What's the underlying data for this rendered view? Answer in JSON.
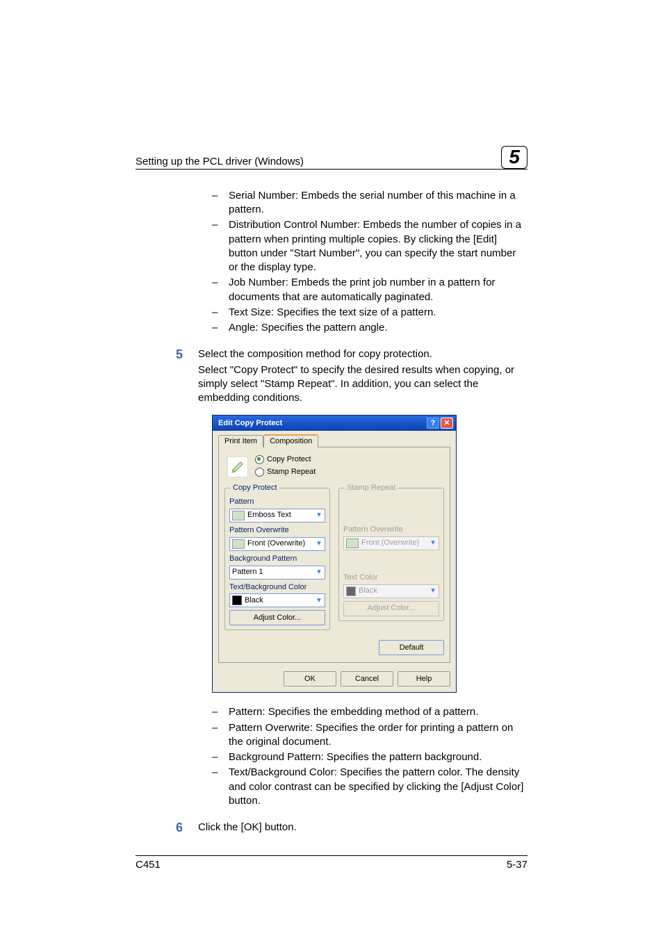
{
  "header": {
    "title": "Setting up the PCL driver (Windows)",
    "chapter": "5"
  },
  "bullets1": [
    "Serial Number: Embeds the serial number of this machine in a pattern.",
    "Distribution Control Number: Embeds the number of copies in a pattern when printing multiple copies. By clicking the [Edit] button under \"Start Number\", you can specify the start number or the display type.",
    "Job Number: Embeds the print job number in a pattern for documents that are automatically paginated.",
    "Text Size: Specifies the text size of a pattern.",
    "Angle: Specifies the pattern angle."
  ],
  "step5": {
    "num": "5",
    "line1": "Select the composition method for copy protection.",
    "line2": "Select \"Copy Protect\" to specify the desired results when copying, or simply select \"Stamp Repeat\". In addition, you can select the embedding conditions."
  },
  "dialog": {
    "title": "Edit Copy Protect",
    "tabs": {
      "t1": "Print Item",
      "t2": "Composition"
    },
    "radios": {
      "r1": "Copy Protect",
      "r2": "Stamp Repeat"
    },
    "left": {
      "group": "Copy Protect",
      "pattern_label": "Pattern",
      "pattern_value": "Emboss Text",
      "overwrite_label": "Pattern Overwrite",
      "overwrite_value": "Front (Overwrite)",
      "bg_label": "Background Pattern",
      "bg_value": "Pattern 1",
      "color_label": "Text/Background Color",
      "color_value": "Black",
      "adjust": "Adjust Color..."
    },
    "right": {
      "group": "Stamp Repeat",
      "overwrite_label": "Pattern Overwrite",
      "overwrite_value": "Front (Overwrite)",
      "color_label": "Text Color",
      "color_value": "Black",
      "adjust": "Adjust Color..."
    },
    "default_btn": "Default",
    "ok": "OK",
    "cancel": "Cancel",
    "help": "Help"
  },
  "bullets2": [
    "Pattern: Specifies the embedding method of a pattern.",
    "Pattern Overwrite: Specifies the order for printing a pattern on the original document.",
    "Background Pattern: Specifies the pattern background.",
    "Text/Background Color: Specifies the pattern color. The density and color contrast can be specified by clicking the [Adjust Color] button."
  ],
  "step6": {
    "num": "6",
    "line1": "Click the [OK] button."
  },
  "footer": {
    "left": "C451",
    "right": "5-37"
  }
}
